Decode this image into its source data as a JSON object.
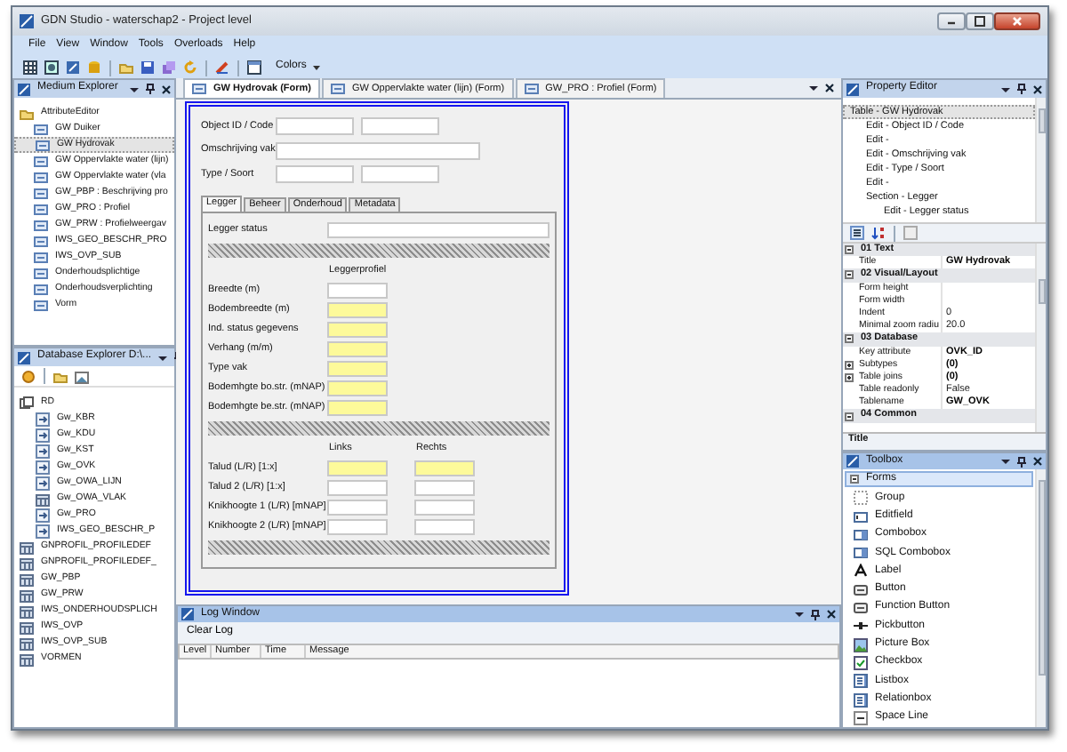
{
  "window": {
    "title": "GDN Studio - waterschap2 - Project level"
  },
  "menu": [
    "File",
    "View",
    "Window",
    "Tools",
    "Overloads",
    "Help"
  ],
  "toolbar": {
    "colors_label": "Colors"
  },
  "medium_explorer": {
    "title": "Medium Explorer",
    "items": [
      {
        "label": "AttributeEditor",
        "kind": "folder",
        "selected": false,
        "children": [
          {
            "label": "GW Duiker",
            "kind": "form",
            "selected": false
          },
          {
            "label": "GW Hydrovak",
            "kind": "form",
            "selected": true
          },
          {
            "label": "GW Oppervlakte water (lijn)",
            "kind": "form",
            "selected": false
          },
          {
            "label": "GW Oppervlakte water (vla",
            "kind": "form",
            "selected": false
          },
          {
            "label": "GW_PBP : Beschrijving pro",
            "kind": "form",
            "selected": false
          },
          {
            "label": "GW_PRO : Profiel",
            "kind": "form",
            "selected": false
          },
          {
            "label": "GW_PRW : Profielweergav",
            "kind": "form",
            "selected": false
          },
          {
            "label": "IWS_GEO_BESCHR_PRO",
            "kind": "form",
            "selected": false
          },
          {
            "label": "IWS_OVP_SUB",
            "kind": "form",
            "selected": false
          },
          {
            "label": "Onderhoudsplichtige",
            "kind": "form",
            "selected": false
          },
          {
            "label": "Onderhoudsverplichting",
            "kind": "form",
            "selected": false
          },
          {
            "label": "Vorm",
            "kind": "form",
            "selected": false
          }
        ]
      }
    ]
  },
  "database_explorer": {
    "title": "Database Explorer D:\\...",
    "items": [
      {
        "label": "RD",
        "kind": "database",
        "children": [
          {
            "label": "Gw_KBR",
            "kind": "view"
          },
          {
            "label": "Gw_KDU",
            "kind": "view"
          },
          {
            "label": "Gw_KST",
            "kind": "view"
          },
          {
            "label": "Gw_OVK",
            "kind": "view"
          },
          {
            "label": "Gw_OWA_LIJN",
            "kind": "view"
          },
          {
            "label": "Gw_OWA_VLAK",
            "kind": "table"
          },
          {
            "label": "Gw_PRO",
            "kind": "view"
          },
          {
            "label": "IWS_GEO_BESCHR_P",
            "kind": "view"
          }
        ]
      },
      {
        "label": "GNPROFIL_PROFILEDEF",
        "kind": "table"
      },
      {
        "label": "GNPROFIL_PROFILEDEF_",
        "kind": "table"
      },
      {
        "label": "GW_PBP",
        "kind": "table"
      },
      {
        "label": "GW_PRW",
        "kind": "table"
      },
      {
        "label": "IWS_ONDERHOUDSPLICH",
        "kind": "table"
      },
      {
        "label": "IWS_OVP",
        "kind": "table"
      },
      {
        "label": "IWS_OVP_SUB",
        "kind": "table"
      },
      {
        "label": "VORMEN",
        "kind": "table"
      }
    ]
  },
  "document_tabs": [
    {
      "label": "GW Hydrovak (Form)",
      "selected": true
    },
    {
      "label": "GW Oppervlakte water (lijn) (Form)",
      "selected": false
    },
    {
      "label": "GW_PRO : Profiel (Form)",
      "selected": false
    }
  ],
  "form": {
    "top_rows": [
      {
        "label": "Object ID / Code",
        "fields": [
          {
            "required": false
          },
          {
            "required": false
          }
        ]
      },
      {
        "label": "Omschrijving vak",
        "fields": [
          {
            "required": false
          }
        ]
      },
      {
        "label": "Type / Soort",
        "fields": [
          {
            "required": false
          },
          {
            "required": false
          }
        ]
      }
    ],
    "tabs": [
      {
        "label": "Legger",
        "selected": true
      },
      {
        "label": "Beheer",
        "selected": false
      },
      {
        "label": "Onderhoud",
        "selected": false
      },
      {
        "label": "Metadata",
        "selected": false
      }
    ],
    "sections": [
      {
        "rows": [
          {
            "label": "Legger status",
            "fields": [
              {
                "required": false
              }
            ]
          }
        ]
      },
      {
        "headers": [
          "Leggerprofiel"
        ],
        "rows": [
          {
            "label": "Breedte (m)",
            "fields": [
              {
                "required": false
              }
            ]
          },
          {
            "label": "Bodembreedte (m)",
            "fields": [
              {
                "required": true
              }
            ]
          },
          {
            "label": "Ind. status gegevens",
            "fields": [
              {
                "required": true
              }
            ]
          },
          {
            "label": "Verhang (m/m)",
            "fields": [
              {
                "required": true
              }
            ]
          },
          {
            "label": "Type vak",
            "fields": [
              {
                "required": true
              }
            ]
          },
          {
            "label": "Bodemhgte bo.str. (mNAP)",
            "fields": [
              {
                "required": true
              }
            ]
          },
          {
            "label": "Bodemhgte be.str. (mNAP)",
            "fields": [
              {
                "required": true
              }
            ]
          }
        ]
      },
      {
        "headers": [
          "Links",
          "Rechts"
        ],
        "rows": [
          {
            "label": "Talud (L/R) [1:x]",
            "fields": [
              {
                "required": true
              },
              {
                "required": true
              }
            ]
          },
          {
            "label": "Talud 2 (L/R) [1:x]",
            "fields": [
              {
                "required": false
              },
              {
                "required": false
              }
            ]
          },
          {
            "label": "Knikhoogte 1 (L/R) [mNAP]",
            "fields": [
              {
                "required": false
              },
              {
                "required": false
              }
            ]
          },
          {
            "label": "Knikhoogte 2 (L/R) [mNAP]",
            "fields": [
              {
                "required": false
              },
              {
                "required": false
              }
            ]
          }
        ]
      }
    ]
  },
  "log_window": {
    "title": "Log Window",
    "clear_button": "Clear Log",
    "columns": [
      "Level",
      "Number",
      "Time",
      "Message"
    ]
  },
  "property_editor": {
    "title": "Property Editor",
    "tree": [
      {
        "label": "Table - GW Hydrovak",
        "selected": true,
        "children": [
          {
            "label": "Edit - Object ID / Code",
            "selected": false
          },
          {
            "label": "Edit -",
            "selected": false
          },
          {
            "label": "Edit - Omschrijving vak",
            "selected": false
          },
          {
            "label": "Edit - Type / Soort",
            "selected": false
          },
          {
            "label": "Edit -",
            "selected": false
          },
          {
            "label": "Section - Legger",
            "selected": false,
            "children": [
              {
                "label": "Edit - Legger status",
                "selected": false
              }
            ]
          }
        ]
      }
    ],
    "grid": [
      {
        "kind": "category",
        "label": "01 Text",
        "expanded": true
      },
      {
        "kind": "property",
        "label": "Title",
        "value": "GW Hydrovak",
        "bold": true
      },
      {
        "kind": "category",
        "label": "02 Visual/Layout",
        "expanded": true
      },
      {
        "kind": "property",
        "label": "Form height"
      },
      {
        "kind": "property",
        "label": "Form width"
      },
      {
        "kind": "property",
        "label": "Indent",
        "value": "0",
        "bold": false
      },
      {
        "kind": "property",
        "label": "Minimal zoom radiu",
        "value": "20.0",
        "bold": false
      },
      {
        "kind": "category",
        "label": "03 Database",
        "expanded": true
      },
      {
        "kind": "property",
        "label": "Key attribute",
        "value": "OVK_ID",
        "bold": true
      },
      {
        "kind": "property",
        "label": "Subtypes",
        "value": "(0)",
        "bold": true,
        "expanded": false
      },
      {
        "kind": "property",
        "label": "Table joins",
        "value": "(0)",
        "bold": true,
        "expanded": false
      },
      {
        "kind": "property",
        "label": "Table readonly",
        "value": "False",
        "bold": false
      },
      {
        "kind": "property",
        "label": "Tablename",
        "value": "GW_OVK",
        "bold": true
      },
      {
        "kind": "category",
        "label": "04 Common",
        "expanded": true
      }
    ],
    "description_title": "Title"
  },
  "toolbox": {
    "title": "Toolbox",
    "category": {
      "label": "Forms",
      "expanded": true,
      "selected": true
    },
    "items": [
      {
        "label": "Group",
        "kind": "group"
      },
      {
        "label": "Editfield",
        "kind": "editfield"
      },
      {
        "label": "Combobox",
        "kind": "combobox"
      },
      {
        "label": "SQL Combobox",
        "kind": "combobox"
      },
      {
        "label": "Label",
        "kind": "label"
      },
      {
        "label": "Button",
        "kind": "button"
      },
      {
        "label": "Function Button",
        "kind": "button"
      },
      {
        "label": "Pickbutton",
        "kind": "pickbutton"
      },
      {
        "label": "Picture Box",
        "kind": "picture"
      },
      {
        "label": "Checkbox",
        "kind": "checkbox"
      },
      {
        "label": "Listbox",
        "kind": "listbox"
      },
      {
        "label": "Relationbox",
        "kind": "listbox"
      },
      {
        "label": "Space Line",
        "kind": "spaceline"
      }
    ]
  }
}
